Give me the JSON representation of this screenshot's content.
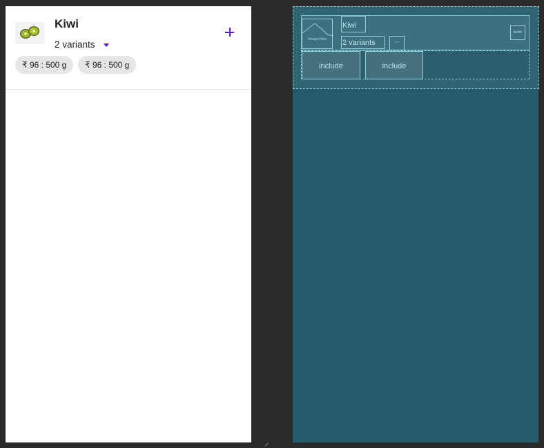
{
  "design": {
    "item": {
      "title": "Kiwi",
      "variants_label": "2 variants",
      "image_icon": "kiwi-fruit-image",
      "add_icon": "plus-icon",
      "dropdown_icon": "dropdown-arrow-icon",
      "chips": [
        {
          "label": "₹ 96 : 500 g"
        },
        {
          "label": "₹ 96 : 500 g"
        }
      ]
    },
    "accent_color": "#5b12e8"
  },
  "blueprint": {
    "image_label": "ImageView",
    "title_label": "Kiwi",
    "variants_label": "2 variants",
    "dropdown_label": "—",
    "add_label": "incl/n",
    "include_labels": [
      "include",
      "include"
    ],
    "background_color": "#245c6c"
  }
}
